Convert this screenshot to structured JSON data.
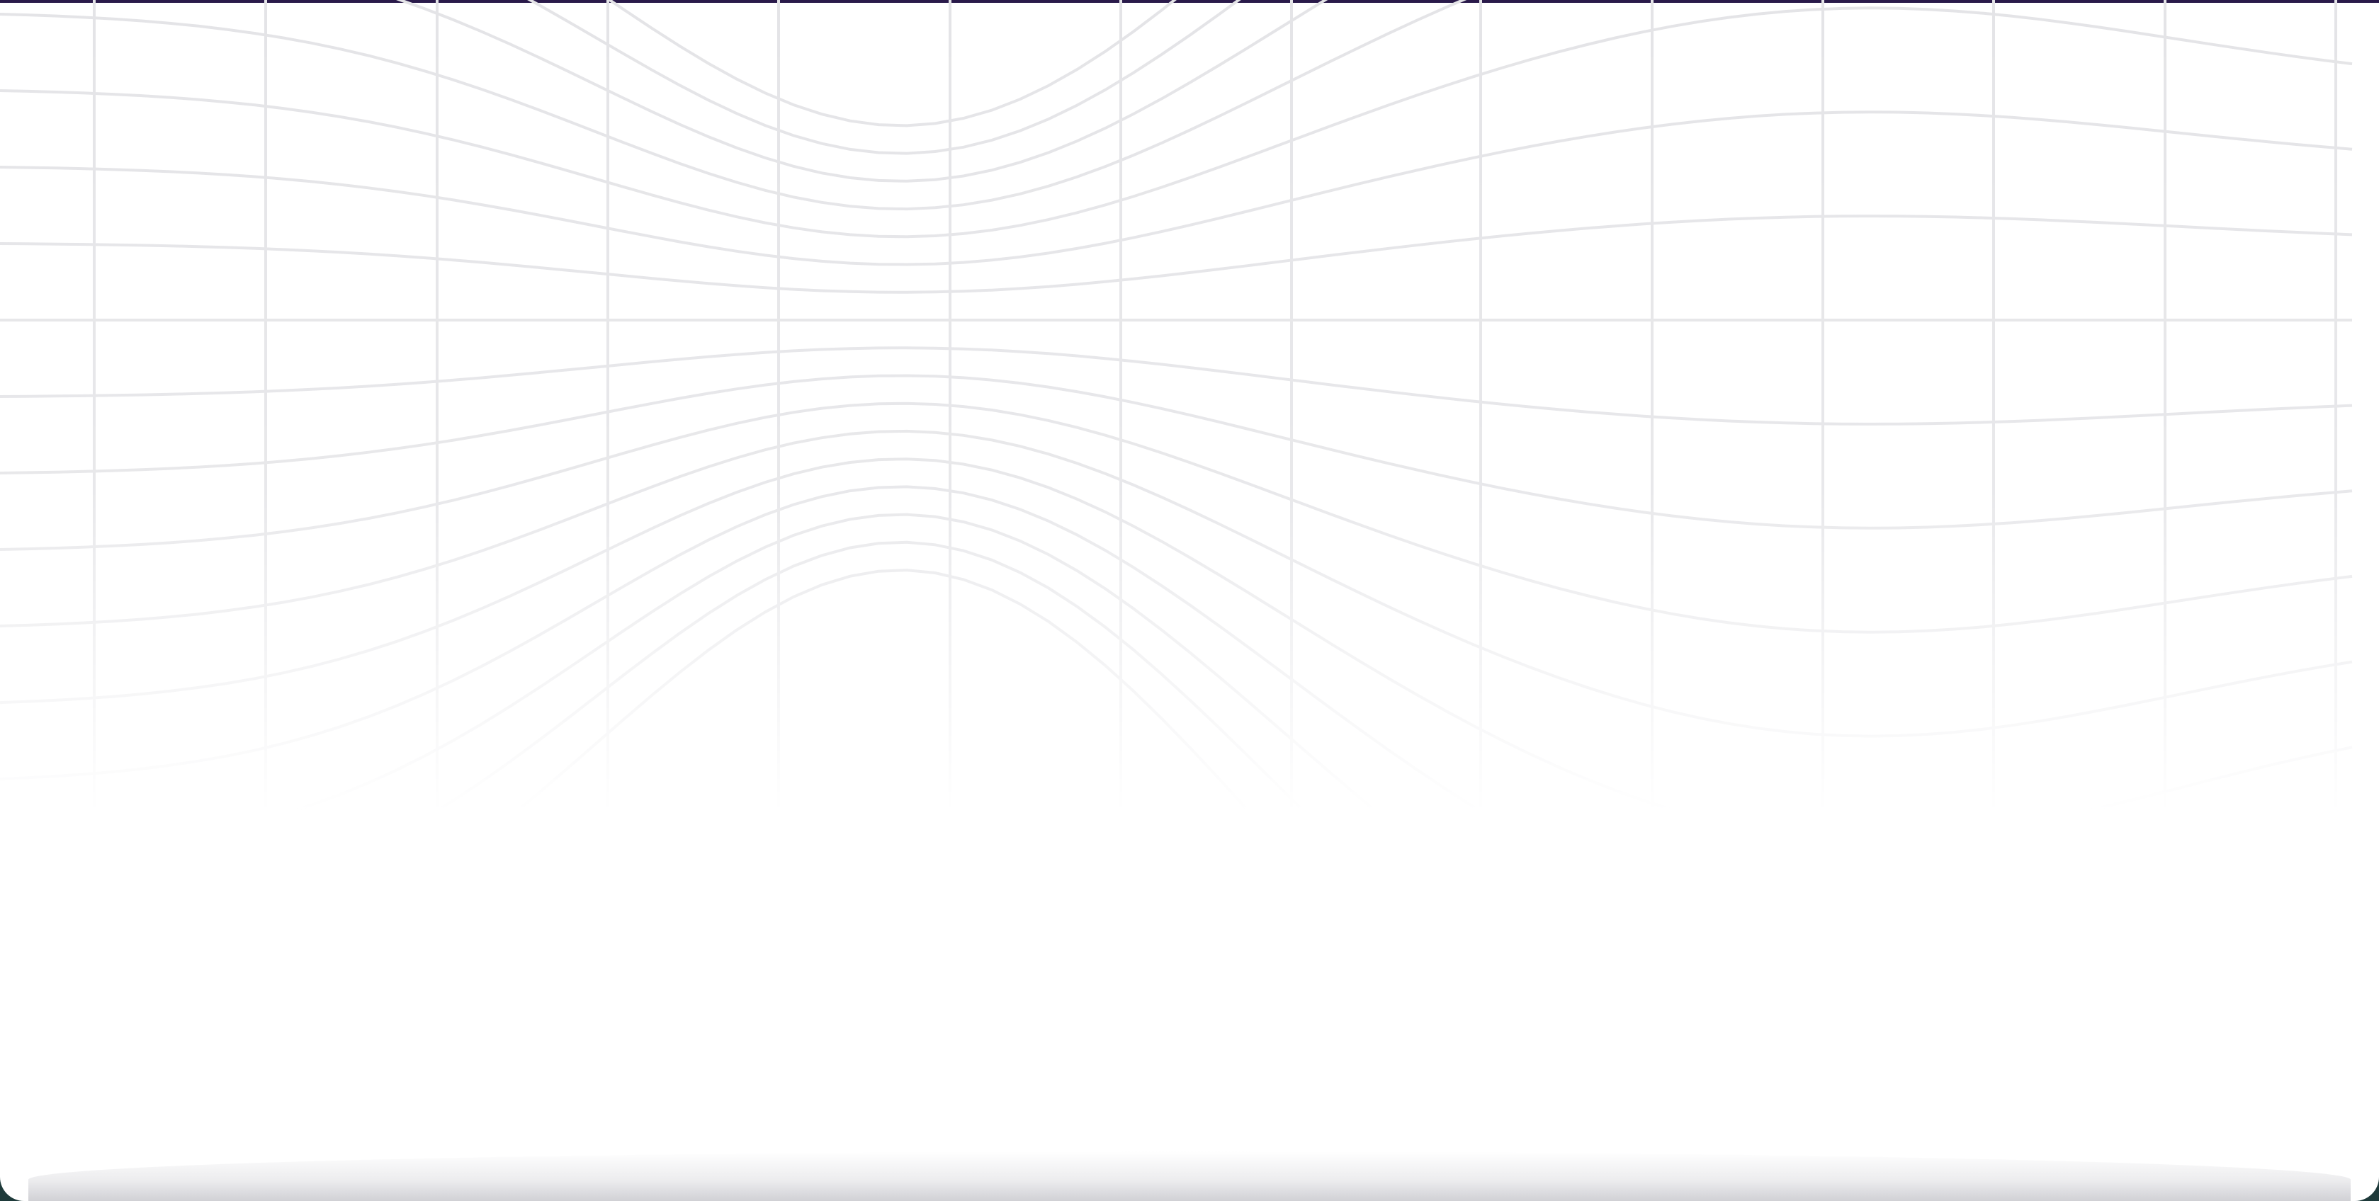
{
  "theme": {
    "background": "#ffffff",
    "accent_top": "#2a1a4a",
    "frame_bottom": "#1e3a3a",
    "grid_line": "#e4e4e7"
  },
  "decor": {
    "background_pattern": "warped-grid"
  }
}
